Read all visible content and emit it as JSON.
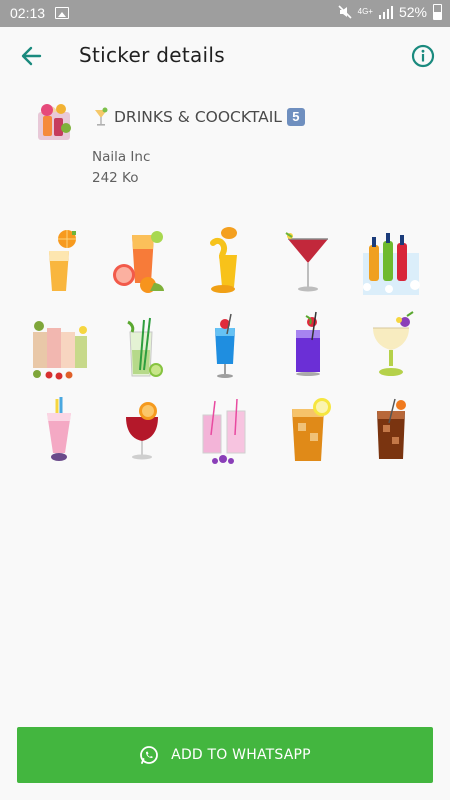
{
  "status_bar": {
    "time": "02:13",
    "network_label": "4G+",
    "battery_text": "52%",
    "icons": [
      "image-icon",
      "mute-icon",
      "signal-icon",
      "battery-icon"
    ]
  },
  "app_bar": {
    "title": "Sticker details",
    "back_icon": "arrow-back-icon",
    "info_icon": "info-icon",
    "accent_color": "#1a8a7e"
  },
  "pack": {
    "name": "DRINKS & COOCKTAIL",
    "name_badge": "5",
    "publisher": "Naila Inc",
    "size": "242 Ko"
  },
  "stickers": [
    {
      "name": "orange-juice-sticker"
    },
    {
      "name": "grapefruit-juice-sticker"
    },
    {
      "name": "mango-juice-splash-sticker"
    },
    {
      "name": "martini-cocktail-sticker"
    },
    {
      "name": "soda-bottles-ice-sticker"
    },
    {
      "name": "smoothies-sticker"
    },
    {
      "name": "mojito-sticker"
    },
    {
      "name": "blue-cocktail-sticker"
    },
    {
      "name": "purple-cocktail-sticker"
    },
    {
      "name": "pina-colada-sticker"
    },
    {
      "name": "pink-milkshake-sticker"
    },
    {
      "name": "red-sangria-sticker"
    },
    {
      "name": "pink-lemonade-sticker"
    },
    {
      "name": "iced-tea-lemon-sticker"
    },
    {
      "name": "cola-ice-sticker"
    }
  ],
  "add_button": {
    "label": "ADD TO WHATSAPP",
    "color": "#43b63f",
    "icon": "whatsapp-icon"
  }
}
